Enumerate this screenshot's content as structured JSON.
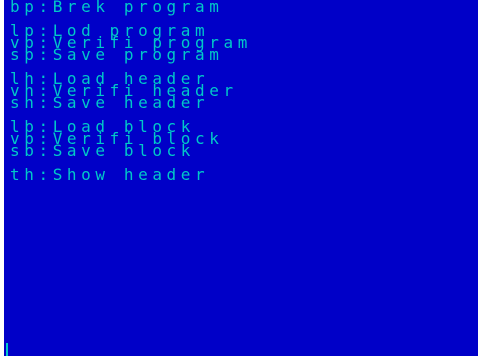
{
  "colors": {
    "paper": "#0000c8",
    "ink": "#00c8c8",
    "border": "#ffffff"
  },
  "menu": {
    "items": [
      "bp:Brek program",
      "",
      "lp:Lod program",
      "vp:Verifi program",
      "sp:Save program",
      "",
      "lh:Load header",
      "vh:Verifi header",
      "sh:Save header",
      "",
      "lb:Load block",
      "vb:Verifi block",
      "sb:Save block",
      "",
      "th:Show header"
    ]
  }
}
